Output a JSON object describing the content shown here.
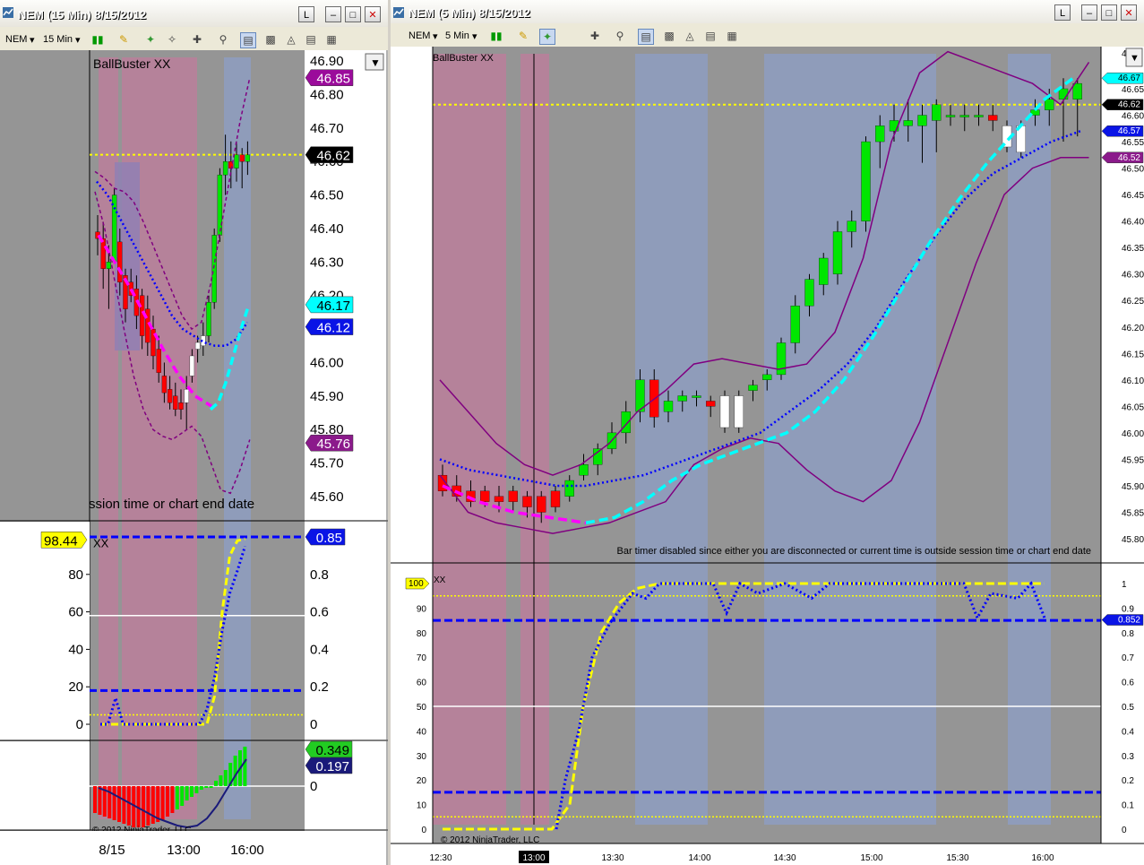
{
  "left_window": {
    "title": "NEM (15 Min)  8/15/2012",
    "toolbar": {
      "instrument": "NEM",
      "interval": "15 Min"
    },
    "panel_label": "BallBuster XX",
    "status_message": "ssion time or chart end date",
    "copyright": "© 2012 NinjaTrader, LLC",
    "price_ticks": [
      "46.90",
      "46.80",
      "46.70",
      "46.60",
      "46.50",
      "46.40",
      "46.30",
      "46.20",
      "46.10",
      "46.00",
      "45.90",
      "45.80",
      "45.70",
      "45.60"
    ],
    "price_markers": [
      {
        "label": "46.85",
        "bg": "#9b0b9b",
        "fg": "#ffffff"
      },
      {
        "label": "46.62",
        "bg": "#000000",
        "fg": "#ffffff"
      },
      {
        "label": "46.17",
        "bg": "#00ffff",
        "fg": "#000000"
      },
      {
        "label": "46.12",
        "bg": "#0a14e6",
        "fg": "#ffffff"
      },
      {
        "label": "45.76",
        "bg": "#8b1a8b",
        "fg": "#ffffff"
      }
    ],
    "osc_left_label": "98.44",
    "osc_label": "XX",
    "osc_right_marker": "0.85",
    "osc_left_ticks": [
      "80",
      "60",
      "40",
      "20",
      "0"
    ],
    "osc_right_ticks": [
      "0.8",
      "0.6",
      "0.4",
      "0.2",
      "0"
    ],
    "hist_markers": [
      "0.349",
      "0.197"
    ],
    "hist_zero": "0",
    "x_ticks": [
      "8/15",
      "13:00",
      "16:00"
    ]
  },
  "right_window": {
    "title": "NEM (5 Min)  8/15/2012",
    "toolbar": {
      "instrument": "NEM",
      "interval": "5 Min"
    },
    "panel_label": "BallBuster XX",
    "status_message": "Bar timer disabled since either you are disconnected or current time is outside session time or chart end date",
    "copyright": "© 2012 NinjaTrader, LLC",
    "price_ticks": [
      "46.65",
      "46.60",
      "46.55",
      "46.50",
      "46.45",
      "46.40",
      "46.35",
      "46.30",
      "46.25",
      "46.20",
      "46.15",
      "46.10",
      "46.05",
      "46.00",
      "45.95",
      "45.90",
      "45.85",
      "45.80"
    ],
    "price_top_partial": "46.",
    "price_markers": [
      {
        "label": "46.67",
        "bg": "#00ffff",
        "fg": "#000000"
      },
      {
        "label": "46.62",
        "bg": "#000000",
        "fg": "#ffffff"
      },
      {
        "label": "46.57",
        "bg": "#0a14e6",
        "fg": "#ffffff"
      },
      {
        "label": "46.52",
        "bg": "#8b1a8b",
        "fg": "#ffffff"
      }
    ],
    "osc_left_label": "100",
    "osc_label": "XX",
    "osc_right_marker": "0.852",
    "osc_left_ticks": [
      "90",
      "80",
      "70",
      "60",
      "50",
      "40",
      "30",
      "20",
      "10",
      "0"
    ],
    "osc_right_ticks": [
      "1",
      "0.9",
      "0.8",
      "0.7",
      "0.6",
      "0.5",
      "0.4",
      "0.3",
      "0.2",
      "0.1",
      "0"
    ],
    "x_ticks": [
      "12:30",
      "13:00",
      "13:30",
      "14:00",
      "14:30",
      "15:00",
      "15:30",
      "16:00"
    ]
  },
  "colors": {
    "candle_up": "#00e600",
    "candle_down": "#ff0000",
    "candle_neutral": "#ffffff",
    "band": "#800080",
    "ma_blue": "#0000ff",
    "ma_cyan": "#00ffff",
    "ma_magenta": "#ff00ff",
    "yellow": "#ffff00",
    "pink_zone": "#b5829a",
    "blue_zone": "#8f9cba",
    "bg": "#959595"
  }
}
